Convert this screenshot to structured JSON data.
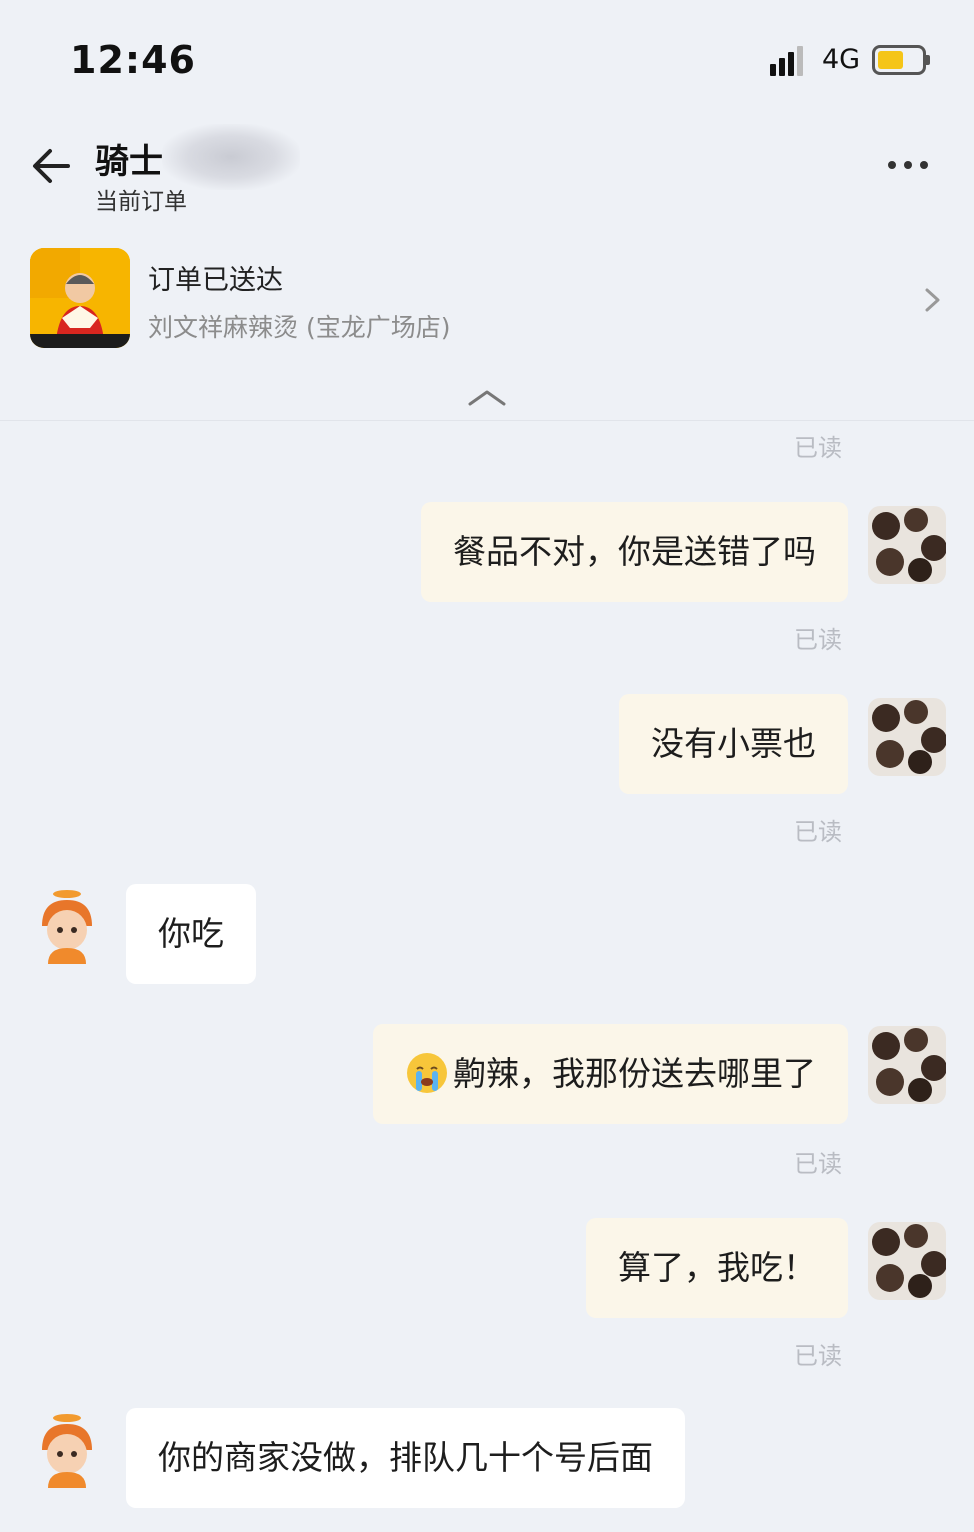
{
  "status_bar": {
    "time": "12:46",
    "network": "4G",
    "battery_level": 0.6
  },
  "header": {
    "title": "骑士",
    "subtitle": "当前订单"
  },
  "order": {
    "status": "订单已送达",
    "shop_name": "刘文祥麻辣烫 (宝龙广场店)"
  },
  "messages": [
    {
      "side": "me",
      "text": "餐品不对，你是送错了吗",
      "read": "已读"
    },
    {
      "side": "me",
      "text": "没有小票也",
      "read": "已读"
    },
    {
      "side": "other",
      "text": "你吃"
    },
    {
      "side": "me",
      "text": "齁辣，我那份送去哪里了",
      "read": "已读",
      "emoji": "crying-face-icon"
    },
    {
      "side": "me",
      "text": "算了，我吃！",
      "read": "已读"
    },
    {
      "side": "other",
      "text": "你的商家没做，排队几十个号后面"
    }
  ],
  "top_read": "已读",
  "colors": {
    "background": "#eef1f6",
    "my_bubble": "#fbf6e9",
    "other_bubble": "#ffffff",
    "read_text": "#b9bcc3",
    "brand_yellow": "#f7b500"
  }
}
